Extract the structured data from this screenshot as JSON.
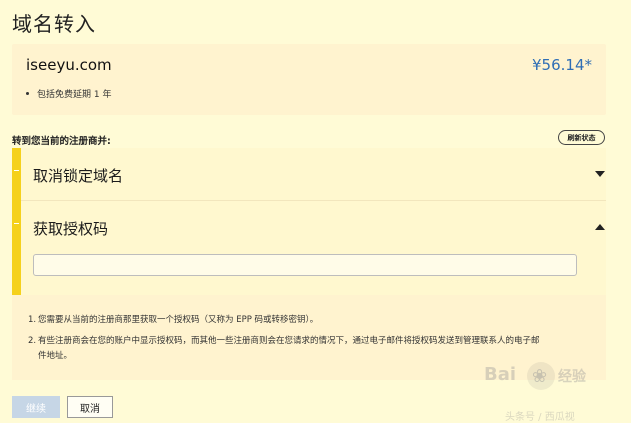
{
  "page": {
    "title": "域名转入"
  },
  "summary": {
    "domain": "iseeyu.com",
    "price": "¥56.14*",
    "extension_note": "包括免费延期 1 年"
  },
  "transfer": {
    "label": "转到您当前的注册商并:",
    "refresh_button": "刷新状态",
    "sections": [
      {
        "title": "取消锁定域名",
        "expanded": false,
        "icon": "chevron-down-icon"
      },
      {
        "title": "获取授权码",
        "expanded": true,
        "icon": "chevron-up-icon"
      }
    ],
    "auth_code_value": ""
  },
  "instructions": [
    {
      "num": "1.",
      "text": "您需要从当前的注册商那里获取一个授权码（又称为 EPP 码或转移密钥）。"
    },
    {
      "num": "2.",
      "text": "有些注册商会在您的账户中显示授权码，而其他一些注册商则会在您请求的情况下，通过电子邮件将授权码发送到管理联系人的电子邮",
      "text2": "件地址。"
    }
  ],
  "actions": {
    "submit": "继续",
    "cancel": "取消"
  },
  "watermark": {
    "brand_a": "Bai",
    "brand_b": "经验",
    "bottom": "头条号 / 西瓜视"
  },
  "colors": {
    "accent_bar": "#f5d11c",
    "price": "#2f6eb5",
    "background": "#fffbd6",
    "panel": "#fff3cf"
  }
}
